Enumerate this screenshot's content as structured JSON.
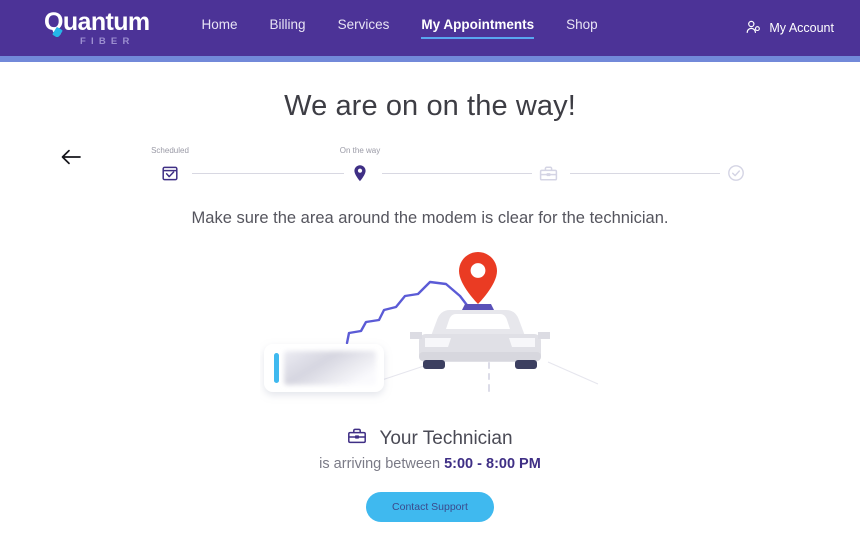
{
  "brand": {
    "name": "Quantum",
    "sub": "FIBER",
    "logo_color": "#ffffff",
    "sub_color": "#9c8fd0",
    "accent_color": "#24b6e8"
  },
  "navbar": {
    "bg_color": "#4c3397",
    "accent_strip_color": "#7289d9",
    "active_underline_color": "#59a6f0",
    "links": [
      {
        "label": "Home",
        "active": false
      },
      {
        "label": "Billing",
        "active": false
      },
      {
        "label": "Services",
        "active": false
      },
      {
        "label": "My Appointments",
        "active": true
      },
      {
        "label": "Shop",
        "active": false
      }
    ],
    "account": {
      "label": "My Account",
      "icon": "user-person-icon"
    }
  },
  "content": {
    "back_icon": "back-arrow-icon",
    "title": "We are on on the way!",
    "subtitle": "Make sure the area around the modem is clear for the technician."
  },
  "stepper": {
    "steps": [
      {
        "label": "Scheduled",
        "icon": "calendar-check-icon",
        "state": "complete"
      },
      {
        "label": "On the way",
        "icon": "map-pin-icon",
        "state": "active"
      },
      {
        "label": "",
        "icon": "toolbox-icon",
        "state": "upcoming"
      },
      {
        "label": "",
        "icon": "check-circle-icon",
        "state": "upcoming"
      }
    ],
    "active_color": "#3f2f85",
    "inactive_color": "#d4d4e4"
  },
  "illustration": {
    "name": "technician-van-on-route-illustration",
    "pin_color": "#ea3b23",
    "route_color": "#5b5bd6",
    "car_body_color": "#e2e2e6",
    "card_accent_color": "#3fb9ef"
  },
  "technician": {
    "icon": "toolbox-icon",
    "heading": "Your Technician",
    "arriving_prefix": "is arriving between ",
    "arrival_window": "5:00 - 8:00 PM"
  },
  "support": {
    "button_label": "Contact Support",
    "button_color": "#3fb9ef",
    "button_text_color": "#3b4a8c"
  }
}
